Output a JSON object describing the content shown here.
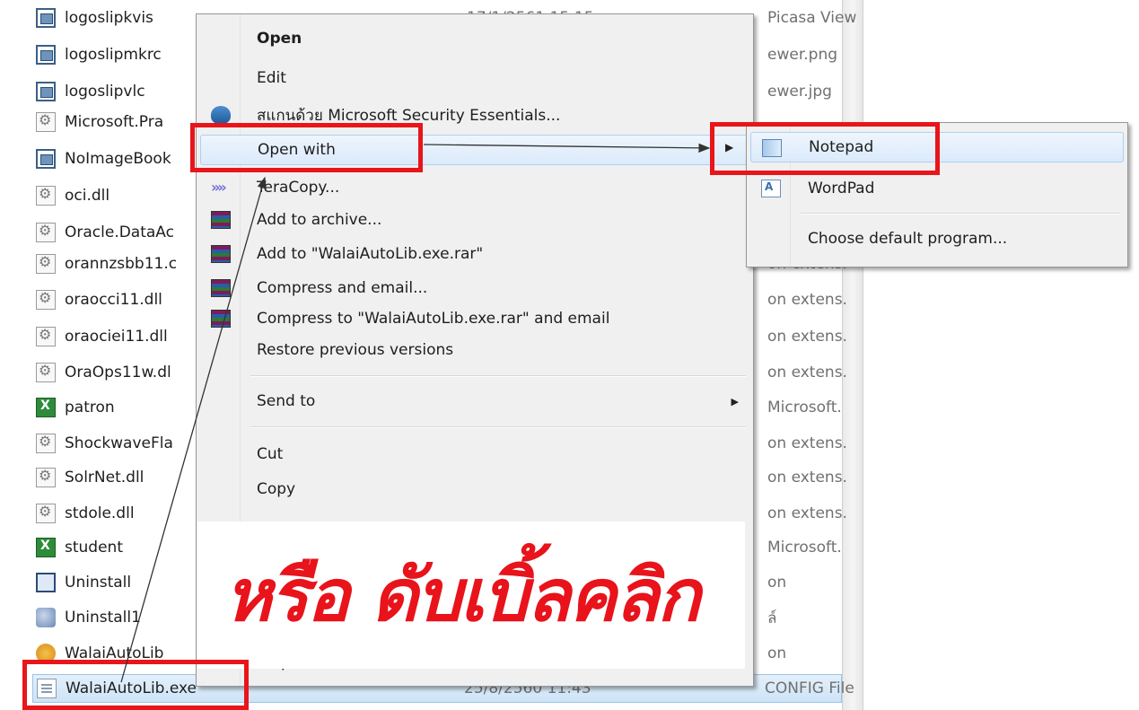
{
  "files": [
    {
      "name": "logoslipkvis",
      "date": "17/1/2561 15:15",
      "type": "Picasa Viewer.jpg",
      "icon": "image-file-icon"
    },
    {
      "name": "logoslipmkrc",
      "date": "",
      "type": "ewer.png",
      "icon": "image-file-icon"
    },
    {
      "name": "logoslipvlc",
      "date": "",
      "type": "ewer.jpg",
      "icon": "image-file-icon"
    },
    {
      "name": "Microsoft.Pra",
      "date": "",
      "type": "",
      "icon": "dll-file-icon"
    },
    {
      "name": "NoImageBook",
      "date": "",
      "type": "",
      "icon": "image-file-icon"
    },
    {
      "name": "oci.dll",
      "date": "",
      "type": "",
      "icon": "dll-file-icon"
    },
    {
      "name": "Oracle.DataAc",
      "date": "",
      "type": "",
      "icon": "dll-file-icon"
    },
    {
      "name": "orannzsbb11.c",
      "date": "",
      "type": "on extens.",
      "icon": "dll-file-icon"
    },
    {
      "name": "oraocci11.dll",
      "date": "",
      "type": "on extens.",
      "icon": "dll-file-icon"
    },
    {
      "name": "oraociei11.dll",
      "date": "",
      "type": "on extens.",
      "icon": "dll-file-icon"
    },
    {
      "name": "OraOps11w.dl",
      "date": "",
      "type": "on extens.",
      "icon": "dll-file-icon"
    },
    {
      "name": "patron",
      "date": "",
      "type": "Microsoft.",
      "icon": "excel-file-icon"
    },
    {
      "name": "ShockwaveFla",
      "date": "",
      "type": "on extens.",
      "icon": "dll-file-icon"
    },
    {
      "name": "SolrNet.dll",
      "date": "",
      "type": "on extens.",
      "icon": "dll-file-icon"
    },
    {
      "name": "stdole.dll",
      "date": "",
      "type": "on extens.",
      "icon": "dll-file-icon"
    },
    {
      "name": "student",
      "date": "",
      "type": "Microsoft.",
      "icon": "excel-file-icon"
    },
    {
      "name": "Uninstall",
      "date": "",
      "type": "on",
      "icon": "uninstall-icon"
    },
    {
      "name": "Uninstall1",
      "date": "",
      "type": "ล์",
      "icon": "uninstall-icon"
    },
    {
      "name": "WalaiAutoLib",
      "date": "",
      "type": "on",
      "icon": "walai-app-icon"
    },
    {
      "name": "WalaiAutoLib.exe",
      "date": "25/8/2560 11:43",
      "type": "CONFIG File",
      "icon": "config-file-icon"
    }
  ],
  "context_menu": {
    "open": "Open",
    "edit": "Edit",
    "scan": "สแกนด้วย Microsoft Security Essentials...",
    "open_with": "Open with",
    "teracopy": "TeraCopy...",
    "add_archive": "Add to archive...",
    "add_rar": "Add to \"WalaiAutoLib.exe.rar\"",
    "compress_email": "Compress and email...",
    "compress_rar_email": "Compress to \"WalaiAutoLib.exe.rar\" and email",
    "restore": "Restore previous versions",
    "send_to": "Send to",
    "cut": "Cut",
    "copy": "Copy",
    "properties": "Properties"
  },
  "submenu": {
    "notepad": "Notepad",
    "wordpad": "WordPad",
    "choose_default": "Choose default program..."
  },
  "annotation": {
    "thai_caption": "หรือ ดับเบิ้ลคลิก",
    "highlight_color": "#e8151a"
  }
}
